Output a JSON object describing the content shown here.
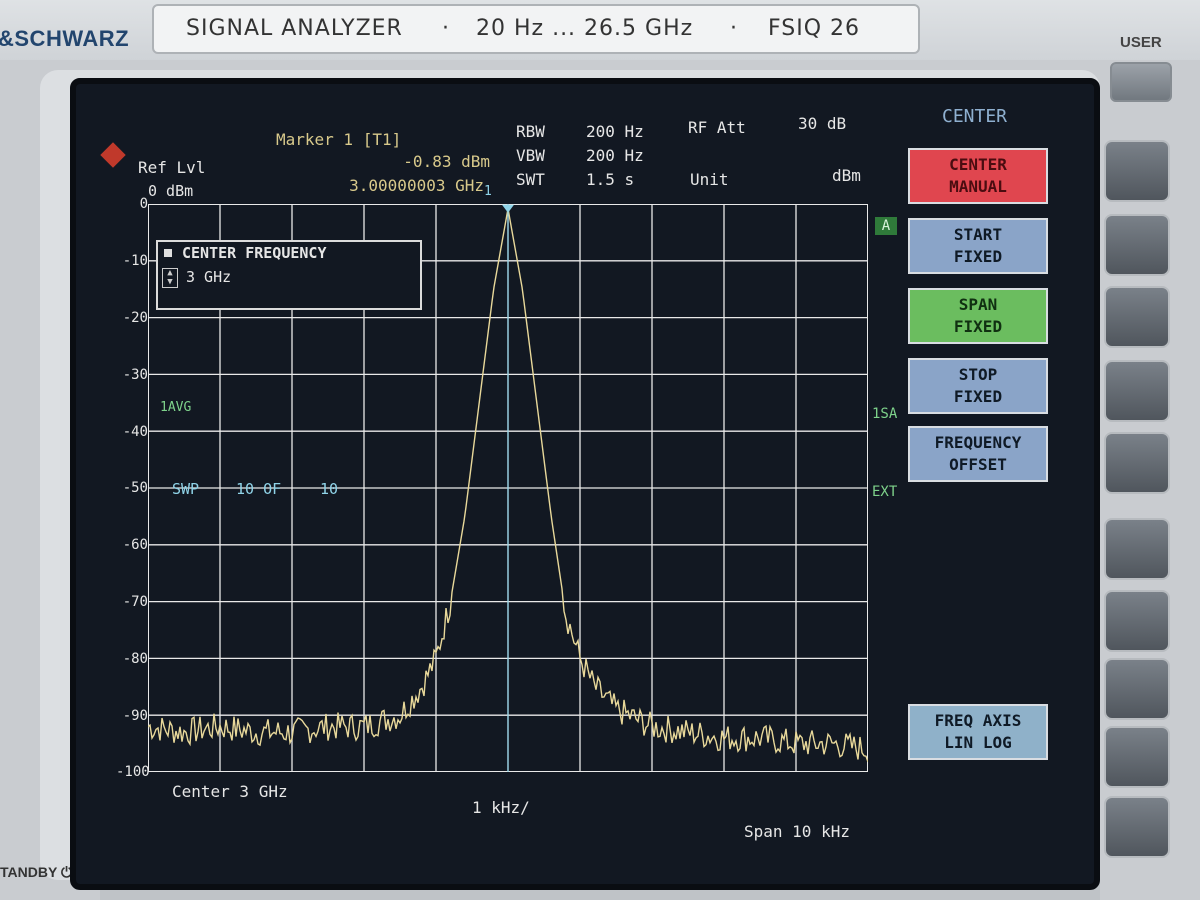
{
  "instrument": {
    "brand": "&SCHWARZ",
    "title_parts": [
      "SIGNAL ANALYZER",
      "·",
      "20 Hz ... 26.5 GHz",
      "·",
      "FSIQ 26"
    ],
    "user_label": "USER",
    "standby_label": "TANDBY"
  },
  "header": {
    "ref_lvl_label": "Ref Lvl",
    "ref_lvl_value": "0 dBm",
    "marker_label": "Marker 1 [T1]",
    "marker_level": "-0.83 dBm",
    "marker_freq": "3.00000003 GHz",
    "rbw_label": "RBW",
    "rbw_value": "200 Hz",
    "vbw_label": "VBW",
    "vbw_value": "200 Hz",
    "swt_label": "SWT",
    "swt_value": "1.5 s",
    "rfatt_label": "RF Att",
    "rfatt_value": "30 dB",
    "unit_label": "Unit",
    "unit_value": "dBm"
  },
  "infobox": {
    "title": "CENTER FREQUENCY",
    "value": "3 GHz"
  },
  "annotations": {
    "avg": "1AVG",
    "swp_label": "SWP",
    "swp_count": "10 OF",
    "swp_total": "10",
    "trace_a": "A",
    "sa": "1SA",
    "ext": "EXT",
    "marker_num": "1"
  },
  "footer": {
    "center": "Center 3 GHz",
    "div": "1 kHz/",
    "span": "Span 10 kHz"
  },
  "menu": {
    "title": "CENTER",
    "keys": [
      {
        "l1": "CENTER",
        "l2": "MANUAL"
      },
      {
        "l1": "START",
        "l2": "FIXED"
      },
      {
        "l1": "SPAN",
        "l2": "FIXED"
      },
      {
        "l1": "STOP",
        "l2": "FIXED"
      },
      {
        "l1": "FREQUENCY",
        "l2": "OFFSET"
      },
      {
        "l1": "FREQ AXIS",
        "l2": "LIN  LOG"
      }
    ]
  },
  "chart_data": {
    "type": "line",
    "yticks": [
      "0",
      "-10",
      "-20",
      "-30",
      "-40",
      "-50",
      "-60",
      "-70",
      "-80",
      "-90",
      "-100"
    ],
    "ylim": [
      -100,
      0
    ],
    "xlim_khz": [
      -5,
      5
    ],
    "series": [
      {
        "x_khz": [
          -5,
          -4.5,
          -4,
          -3.5,
          -3,
          -2.5,
          -2,
          -1.5,
          -1.2,
          -1,
          -0.8,
          -0.6,
          -0.4,
          -0.2,
          0,
          0.2,
          0.4,
          0.6,
          0.8,
          1,
          1.2,
          1.5,
          2,
          2.5,
          3,
          3.5,
          4,
          4.5,
          5
        ],
        "y_dbm": [
          -92,
          -93,
          -92,
          -93,
          -93,
          -92,
          -92,
          -90,
          -85,
          -80,
          -70,
          -55,
          -35,
          -15,
          -0.83,
          -15,
          -35,
          -55,
          -72,
          -80,
          -85,
          -89,
          -92,
          -93,
          -94,
          -94,
          -95,
          -95,
          -96
        ]
      }
    ],
    "marker": {
      "x_khz": 0,
      "y_dbm": -0.83
    },
    "colors": {
      "trace": "#e8d89a",
      "grid": "#e9e9e9",
      "marker": "#8fd3e8"
    }
  }
}
